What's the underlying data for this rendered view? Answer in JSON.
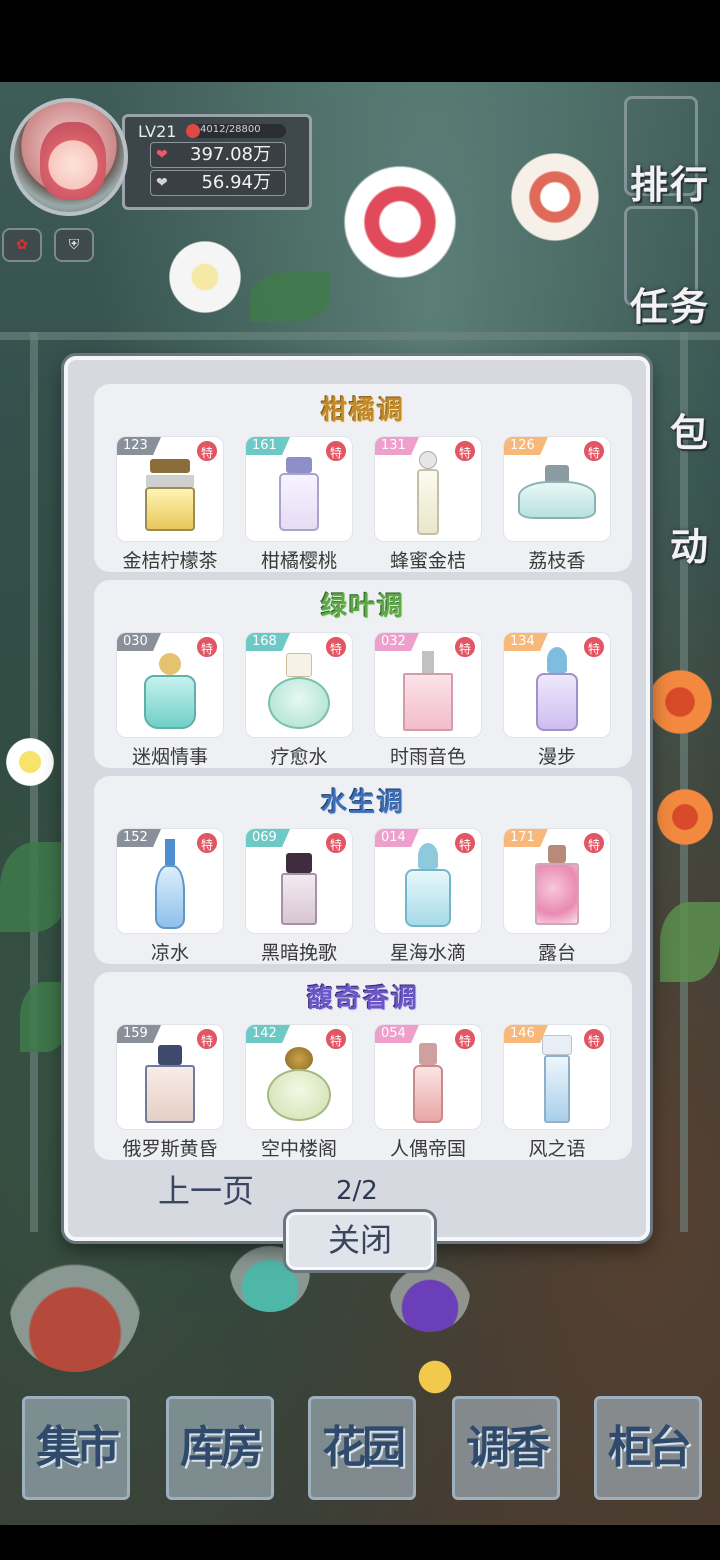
{
  "player": {
    "level": "LV21",
    "exp_text": "4012/28800",
    "exp_fraction": 0.14,
    "currency_1": "397.08万",
    "currency_2": "56.94万"
  },
  "side_menu": {
    "rank": "排行",
    "task": "任务",
    "bag": "包",
    "activity": "动"
  },
  "collection": {
    "special_badge": "特",
    "sections": [
      {
        "title": "柑橘调",
        "items": [
          {
            "num": "123",
            "name": "金桔柠檬茶"
          },
          {
            "num": "161",
            "name": "柑橘樱桃"
          },
          {
            "num": "131",
            "name": "蜂蜜金桔"
          },
          {
            "num": "126",
            "name": "荔枝香"
          }
        ]
      },
      {
        "title": "绿叶调",
        "items": [
          {
            "num": "030",
            "name": "迷烟情事"
          },
          {
            "num": "168",
            "name": "疗愈水"
          },
          {
            "num": "032",
            "name": "时雨音色"
          },
          {
            "num": "134",
            "name": "漫步"
          }
        ]
      },
      {
        "title": "水生调",
        "items": [
          {
            "num": "152",
            "name": "凉水"
          },
          {
            "num": "069",
            "name": "黑暗挽歌"
          },
          {
            "num": "014",
            "name": "星海水滴"
          },
          {
            "num": "171",
            "name": "露台"
          }
        ]
      },
      {
        "title": "馥奇香调",
        "items": [
          {
            "num": "159",
            "name": "俄罗斯黄昏"
          },
          {
            "num": "142",
            "name": "空中楼阁"
          },
          {
            "num": "054",
            "name": "人偶帝国"
          },
          {
            "num": "146",
            "name": "风之语"
          }
        ]
      }
    ],
    "prev_label": "上一页",
    "page": "2/2",
    "close_label": "关闭"
  },
  "bottom_tabs": {
    "market": "集市",
    "store": "库房",
    "garden": "花园",
    "blend": "调香",
    "counter": "柜台"
  }
}
